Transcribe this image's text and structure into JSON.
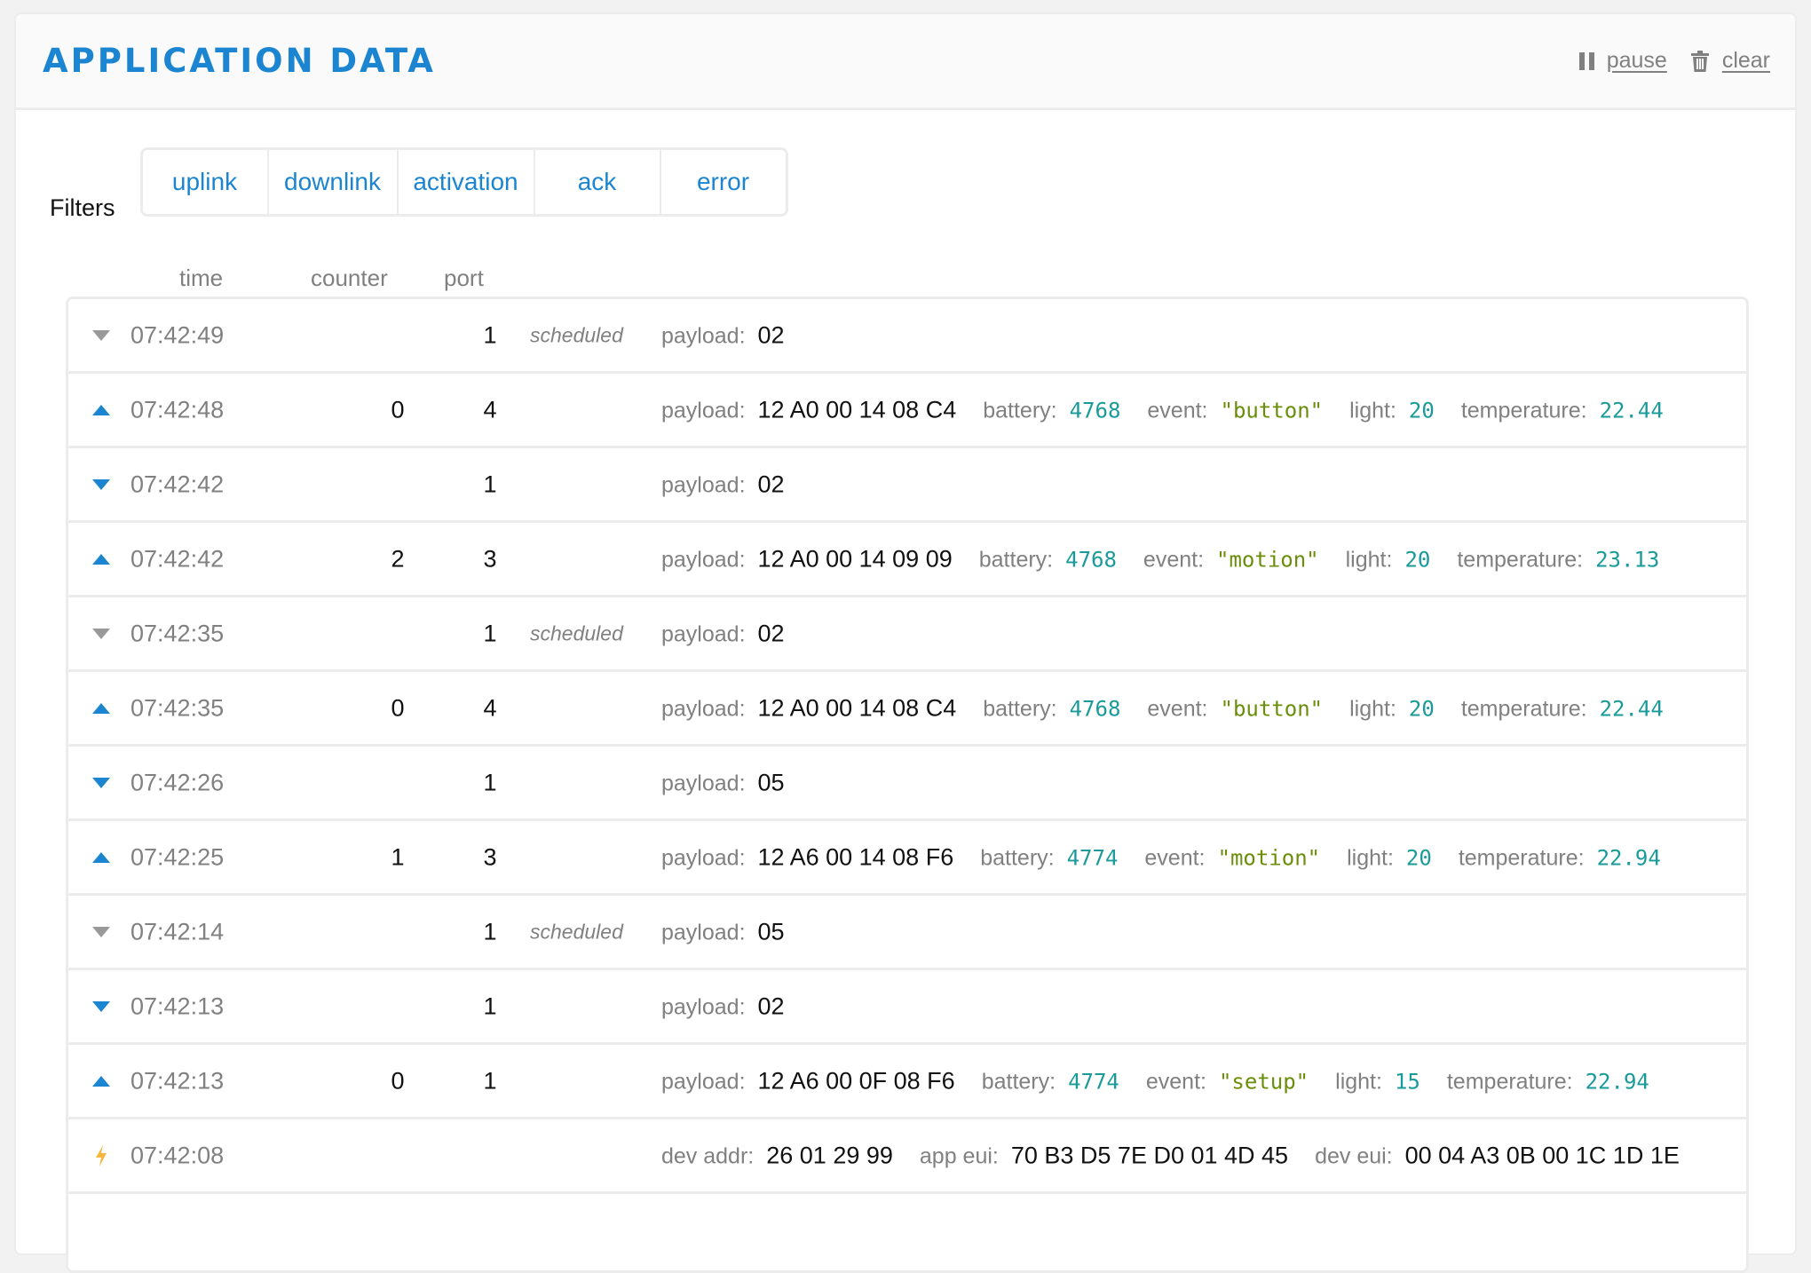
{
  "header": {
    "title": "APPLICATION DATA",
    "pause_label": "pause",
    "clear_label": "clear",
    "pause_icon": "pause-icon",
    "clear_icon": "trash-icon"
  },
  "filters": {
    "label": "Filters",
    "buttons": [
      "uplink",
      "downlink",
      "activation",
      "ack",
      "error"
    ]
  },
  "columns": {
    "time": "time",
    "counter": "counter",
    "port": "port"
  },
  "colors": {
    "accent": "#1c85d1",
    "muted": "#808080",
    "number": "#1a9a9a",
    "string": "#6b8e0a",
    "activation": "#f5b83d"
  },
  "rows": [
    {
      "type": "downlink-scheduled",
      "icon": "triangle-down-icon",
      "time": "07:42:49",
      "counter": "",
      "port": "1",
      "status": "scheduled",
      "fields": [
        {
          "key": "payload:",
          "value": "02",
          "kind": "plain"
        }
      ]
    },
    {
      "type": "uplink",
      "icon": "triangle-up-icon",
      "time": "07:42:48",
      "counter": "0",
      "port": "4",
      "status": "",
      "fields": [
        {
          "key": "payload:",
          "value": "12 A0 00 14 08 C4",
          "kind": "plain"
        },
        {
          "key": "battery:",
          "value": "4768",
          "kind": "num"
        },
        {
          "key": "event:",
          "value": "\"button\"",
          "kind": "str"
        },
        {
          "key": "light:",
          "value": "20",
          "kind": "num"
        },
        {
          "key": "temperature:",
          "value": "22.44",
          "kind": "num"
        }
      ]
    },
    {
      "type": "downlink",
      "icon": "triangle-down-icon",
      "time": "07:42:42",
      "counter": "",
      "port": "1",
      "status": "",
      "fields": [
        {
          "key": "payload:",
          "value": "02",
          "kind": "plain"
        }
      ]
    },
    {
      "type": "uplink",
      "icon": "triangle-up-icon",
      "time": "07:42:42",
      "counter": "2",
      "port": "3",
      "status": "",
      "fields": [
        {
          "key": "payload:",
          "value": "12 A0 00 14 09 09",
          "kind": "plain"
        },
        {
          "key": "battery:",
          "value": "4768",
          "kind": "num"
        },
        {
          "key": "event:",
          "value": "\"motion\"",
          "kind": "str"
        },
        {
          "key": "light:",
          "value": "20",
          "kind": "num"
        },
        {
          "key": "temperature:",
          "value": "23.13",
          "kind": "num"
        }
      ]
    },
    {
      "type": "downlink-scheduled",
      "icon": "triangle-down-icon",
      "time": "07:42:35",
      "counter": "",
      "port": "1",
      "status": "scheduled",
      "fields": [
        {
          "key": "payload:",
          "value": "02",
          "kind": "plain"
        }
      ]
    },
    {
      "type": "uplink",
      "icon": "triangle-up-icon",
      "time": "07:42:35",
      "counter": "0",
      "port": "4",
      "status": "",
      "fields": [
        {
          "key": "payload:",
          "value": "12 A0 00 14 08 C4",
          "kind": "plain"
        },
        {
          "key": "battery:",
          "value": "4768",
          "kind": "num"
        },
        {
          "key": "event:",
          "value": "\"button\"",
          "kind": "str"
        },
        {
          "key": "light:",
          "value": "20",
          "kind": "num"
        },
        {
          "key": "temperature:",
          "value": "22.44",
          "kind": "num"
        }
      ]
    },
    {
      "type": "downlink",
      "icon": "triangle-down-icon",
      "time": "07:42:26",
      "counter": "",
      "port": "1",
      "status": "",
      "fields": [
        {
          "key": "payload:",
          "value": "05",
          "kind": "plain"
        }
      ]
    },
    {
      "type": "uplink",
      "icon": "triangle-up-icon",
      "time": "07:42:25",
      "counter": "1",
      "port": "3",
      "status": "",
      "fields": [
        {
          "key": "payload:",
          "value": "12 A6 00 14 08 F6",
          "kind": "plain"
        },
        {
          "key": "battery:",
          "value": "4774",
          "kind": "num"
        },
        {
          "key": "event:",
          "value": "\"motion\"",
          "kind": "str"
        },
        {
          "key": "light:",
          "value": "20",
          "kind": "num"
        },
        {
          "key": "temperature:",
          "value": "22.94",
          "kind": "num"
        }
      ]
    },
    {
      "type": "downlink-scheduled",
      "icon": "triangle-down-icon",
      "time": "07:42:14",
      "counter": "",
      "port": "1",
      "status": "scheduled",
      "fields": [
        {
          "key": "payload:",
          "value": "05",
          "kind": "plain"
        }
      ]
    },
    {
      "type": "downlink",
      "icon": "triangle-down-icon",
      "time": "07:42:13",
      "counter": "",
      "port": "1",
      "status": "",
      "fields": [
        {
          "key": "payload:",
          "value": "02",
          "kind": "plain"
        }
      ]
    },
    {
      "type": "uplink",
      "icon": "triangle-up-icon",
      "time": "07:42:13",
      "counter": "0",
      "port": "1",
      "status": "",
      "fields": [
        {
          "key": "payload:",
          "value": "12 A6 00 0F 08 F6",
          "kind": "plain"
        },
        {
          "key": "battery:",
          "value": "4774",
          "kind": "num"
        },
        {
          "key": "event:",
          "value": "\"setup\"",
          "kind": "str"
        },
        {
          "key": "light:",
          "value": "15",
          "kind": "num"
        },
        {
          "key": "temperature:",
          "value": "22.94",
          "kind": "num"
        }
      ]
    },
    {
      "type": "activation",
      "icon": "lightning-bolt-icon",
      "time": "07:42:08",
      "counter": "",
      "port": "",
      "status": "",
      "fields": [
        {
          "key": "dev addr:",
          "value": "26 01 29 99",
          "kind": "plain"
        },
        {
          "key": "app eui:",
          "value": "70 B3 D5 7E D0 01 4D 45",
          "kind": "plain"
        },
        {
          "key": "dev eui:",
          "value": "00 04 A3 0B 00 1C 1D 1E",
          "kind": "plain"
        }
      ]
    }
  ]
}
